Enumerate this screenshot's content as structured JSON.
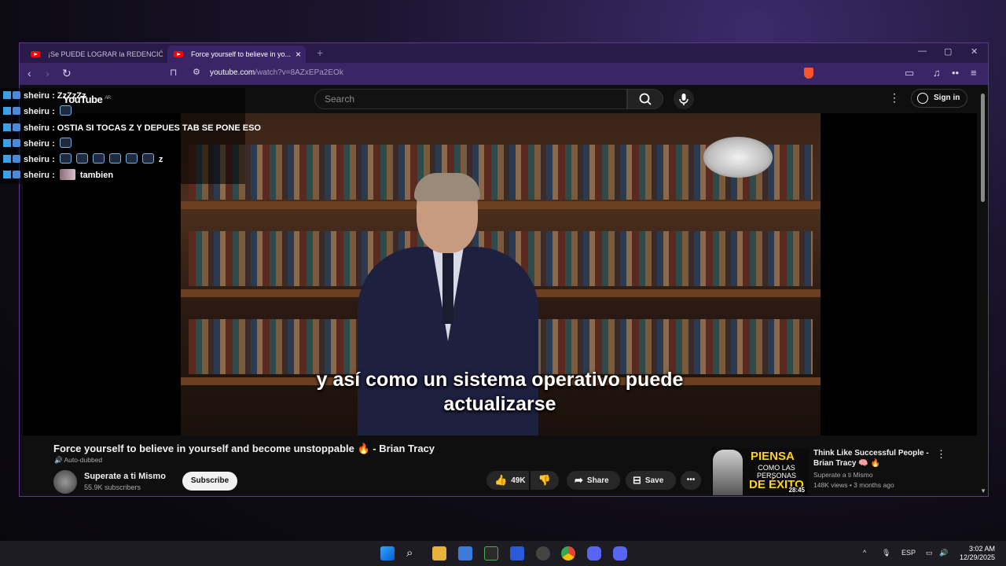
{
  "browser": {
    "tabs": [
      {
        "label": "¡Se PUEDE LOGRAR la REDENCIÓN!..."
      },
      {
        "label": "Force yourself to believe in yo..."
      }
    ],
    "url_host": "youtube.com",
    "url_path": "/watch?v=8AZxEPa2EOk"
  },
  "youtube": {
    "logo": "YouTube",
    "logo_region": "AR",
    "search_placeholder": "Search",
    "sign_in": "Sign in"
  },
  "chat": {
    "username": "sheiru",
    "messages": [
      {
        "text": "ZzZzZz"
      },
      {
        "text": ""
      },
      {
        "text": "OSTIA SI TOCAS Z Y DEPUES TAB SE PONE ESO"
      },
      {
        "text": ""
      },
      {
        "text": "z"
      },
      {
        "text": "tambien"
      }
    ]
  },
  "video": {
    "subtitle_line1": "y así como un sistema operativo puede",
    "subtitle_line2": "actualizarse",
    "title": "Force yourself to believe in yourself and become unstoppable 🔥 - Brian Tracy",
    "auto_dubbed": "Auto-dubbed",
    "channel": "Superate a ti Mismo",
    "subscribers": "55.9K subscribers",
    "subscribe": "Subscribe",
    "likes": "49K",
    "share": "Share",
    "save": "Save"
  },
  "recommendation": {
    "title": "Think Like Successful People - Brian Tracy 🧠 🔥",
    "channel": "Superate a ti Mismo",
    "meta": "148K views • 3 months ago",
    "duration": "28:45",
    "thumb_line1": "PIENSA",
    "thumb_line2": "COMO LAS PERSONAS",
    "thumb_line3": "DE ÉXITO"
  },
  "taskbar": {
    "lang": "ESP",
    "time": "3:02 AM",
    "date": "12/29/2025"
  }
}
